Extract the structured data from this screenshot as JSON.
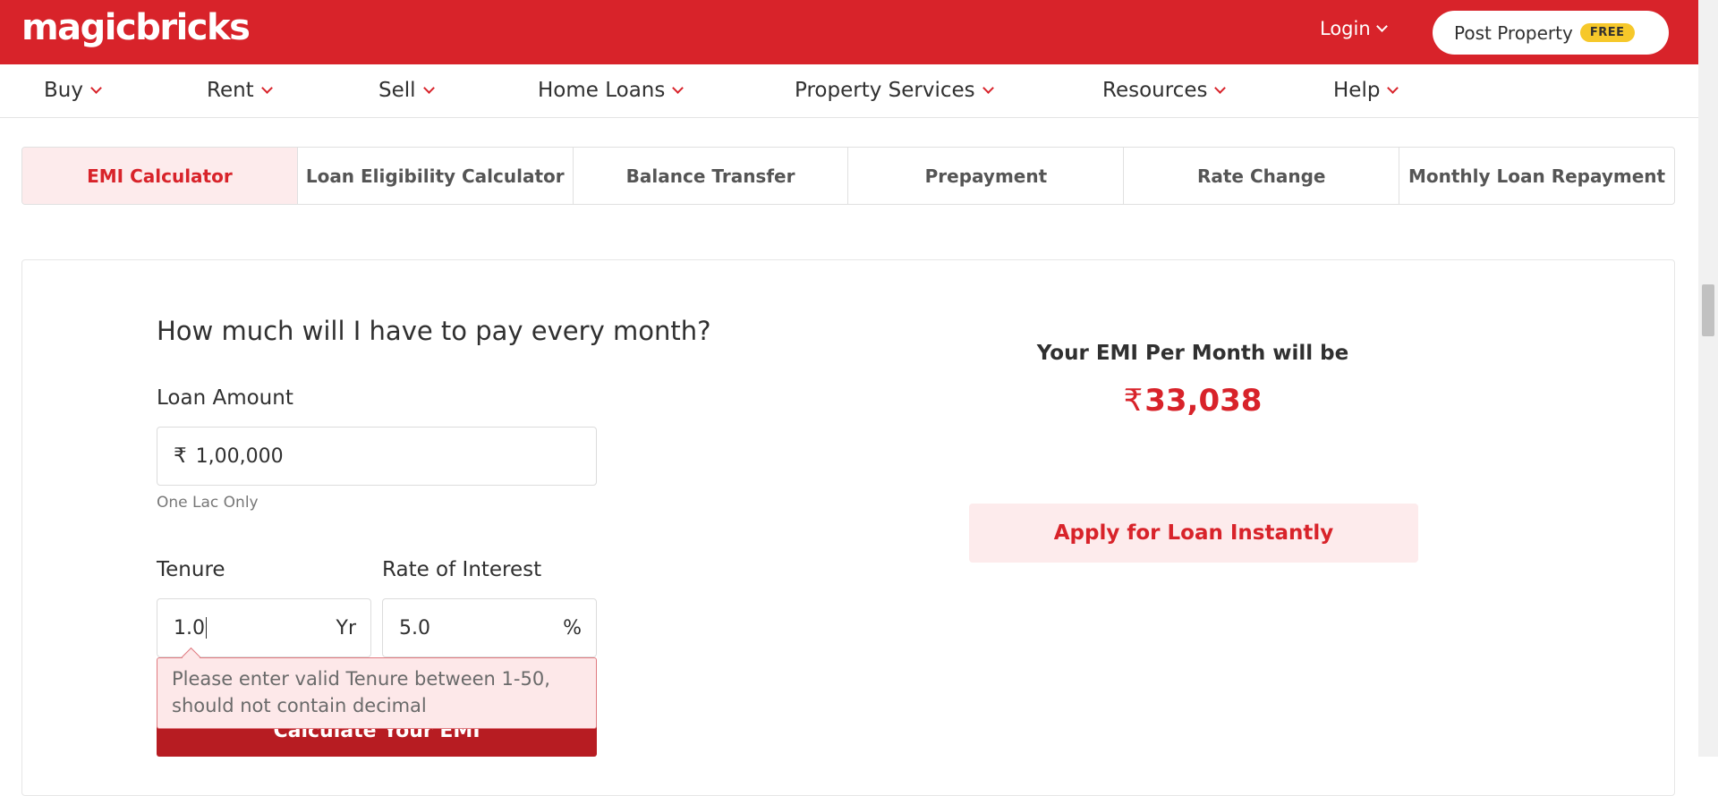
{
  "header": {
    "logo": "magicbricks",
    "login_label": "Login",
    "post_property_label": "Post Property",
    "free_badge": "FREE"
  },
  "nav": {
    "items": [
      {
        "label": "Buy"
      },
      {
        "label": "Rent"
      },
      {
        "label": "Sell"
      },
      {
        "label": "Home Loans"
      },
      {
        "label": "Property Services"
      },
      {
        "label": "Resources"
      },
      {
        "label": "Help"
      }
    ]
  },
  "tabs": [
    {
      "label": "EMI Calculator",
      "active": true
    },
    {
      "label": "Loan Eligibility Calculator"
    },
    {
      "label": "Balance Transfer"
    },
    {
      "label": "Prepayment"
    },
    {
      "label": "Rate Change"
    },
    {
      "label": "Monthly Loan Repayment"
    }
  ],
  "calculator": {
    "question": "How much will I have to pay every month?",
    "loan_amount_label": "Loan Amount",
    "currency_symbol": "₹",
    "loan_amount_value": "1,00,000",
    "loan_amount_hint": "One Lac Only",
    "tenure_label": "Tenure",
    "tenure_value": "1.0",
    "tenure_unit": "Yr",
    "rate_label": "Rate of Interest",
    "rate_value": "5.0",
    "rate_unit": "%",
    "error_message": "Please enter valid Tenure between 1-50, should not contain decimal",
    "calculate_label": "Calculate Your EMI"
  },
  "result": {
    "title": "Your EMI Per Month will be",
    "currency_symbol": "₹",
    "emi_value": "33,038",
    "apply_label": "Apply for Loan Instantly"
  },
  "colors": {
    "brand": "#d8232a",
    "active_tab_bg": "#fdebec",
    "error_bg": "#fde8e9",
    "badge": "#f6c82a"
  }
}
